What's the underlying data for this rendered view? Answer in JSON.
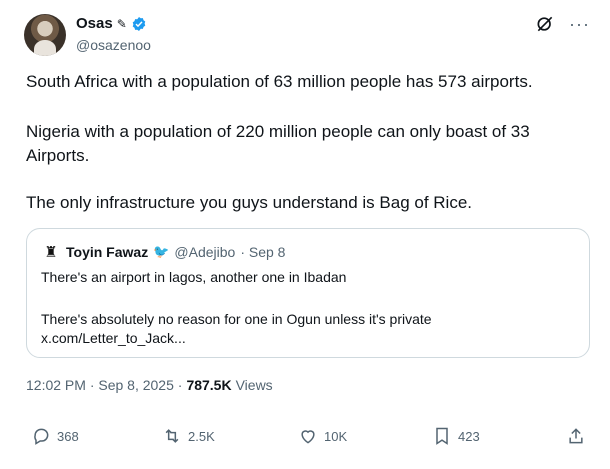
{
  "author": {
    "display_name": "Osas",
    "badge_glyph": "✎",
    "handle": "@osazenoo"
  },
  "tweet": {
    "paragraphs": [
      "South Africa with a population of 63 million people has 573 airports.",
      "Nigeria with a population of 220 million people can only boast of 33 Airports.",
      "The only infrastructure you guys understand is Bag of Rice."
    ]
  },
  "quote": {
    "author_name": "Toyin Fawaz",
    "author_handle": "@Adejibo",
    "date": "· Sep 8",
    "lines": [
      "There's an airport in lagos, another one in Ibadan",
      "There's absolutely no reason for one in Ogun unless it's private",
      "x.com/Letter_to_Jack..."
    ]
  },
  "meta": {
    "time_date": "12:02 PM · Sep 8, 2025 ·",
    "views_count": "787.5K",
    "views_label": "Views"
  },
  "actions": {
    "replies": "368",
    "reposts": "2.5K",
    "likes": "10K",
    "bookmarks": "423"
  },
  "colors": {
    "verified": "#1d9bf0",
    "muted": "#536471",
    "text": "#0f1419",
    "border": "#cfd9de"
  },
  "icons": [
    "verified-badge-icon",
    "grok-icon",
    "more-icon",
    "reply-icon",
    "repost-icon",
    "like-icon",
    "bookmark-icon",
    "share-icon"
  ]
}
